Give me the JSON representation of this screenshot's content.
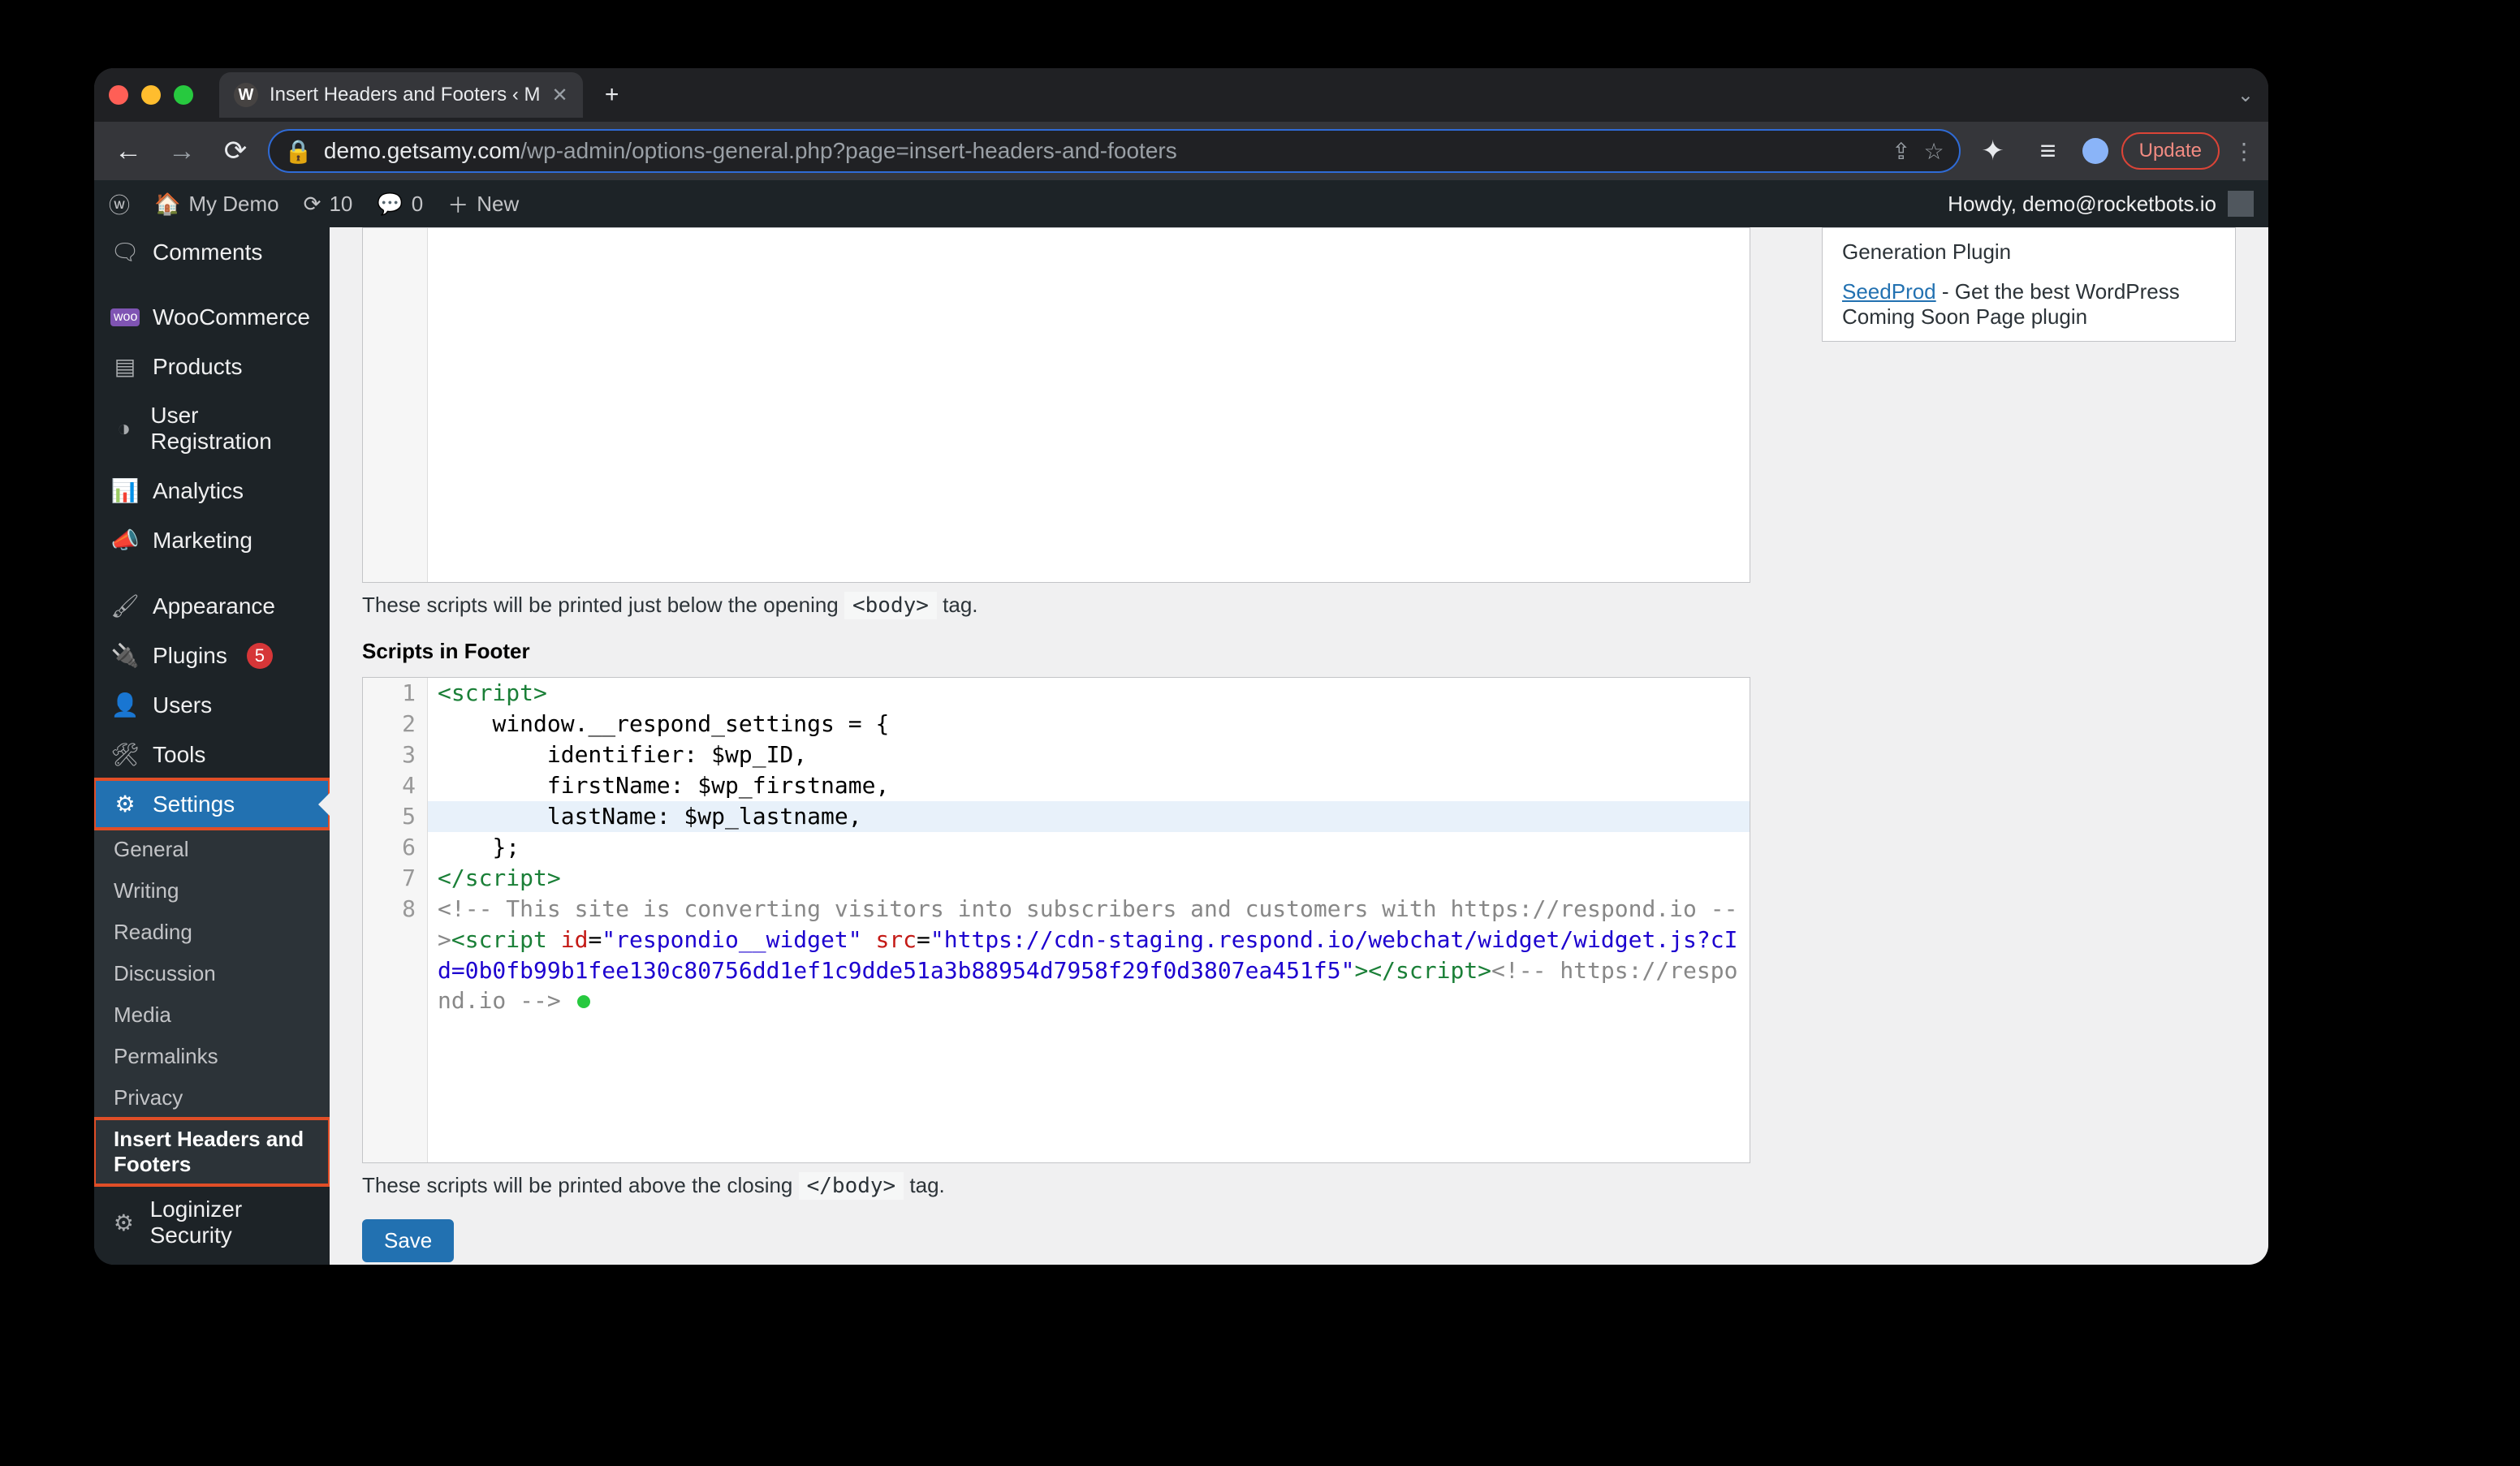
{
  "browser": {
    "tab_title": "Insert Headers and Footers ‹ M",
    "url_host": "demo.getsamy.com",
    "url_path": "/wp-admin/options-general.php?page=insert-headers-and-footers",
    "update_label": "Update"
  },
  "adminbar": {
    "site_name": "My Demo",
    "revisions": "10",
    "comments": "0",
    "new_label": "New",
    "howdy": "Howdy, demo@rocketbots.io"
  },
  "sidebar": {
    "items": [
      {
        "label": "Comments",
        "icon": "💬"
      },
      {
        "label": "WooCommerce",
        "icon": "woo"
      },
      {
        "label": "Products",
        "icon": "▥"
      },
      {
        "label": "User Registration",
        "icon": "◑"
      },
      {
        "label": "Analytics",
        "icon": "📊"
      },
      {
        "label": "Marketing",
        "icon": "📣"
      },
      {
        "label": "Appearance",
        "icon": "🖌"
      },
      {
        "label": "Plugins",
        "icon": "🔌",
        "badge": "5"
      },
      {
        "label": "Users",
        "icon": "👤"
      },
      {
        "label": "Tools",
        "icon": "🛠"
      },
      {
        "label": "Settings",
        "icon": "⚙",
        "current": true
      }
    ],
    "settings_sub": [
      "General",
      "Writing",
      "Reading",
      "Discussion",
      "Media",
      "Permalinks",
      "Privacy"
    ],
    "settings_sub_active": "Insert Headers and Footers",
    "loginizer": "Loginizer Security"
  },
  "content": {
    "body_helper_pre": "These scripts will be printed just below the opening ",
    "body_helper_code": "<body>",
    "body_helper_post": " tag.",
    "footer_label": "Scripts in Footer",
    "footer_helper_pre": "These scripts will be printed above the closing ",
    "footer_helper_code": "</body>",
    "footer_helper_post": " tag.",
    "save_label": "Save",
    "code": {
      "l1_a": "<script>",
      "l2": "    window.__respond_settings = {",
      "l3": "        identifier: $wp_ID,",
      "l4": "        firstName: $wp_firstname,",
      "l5": "        lastName: $wp_lastname,",
      "l6": "    };",
      "l7_a": "</script>",
      "l8_cmt1": "<!-- This site is converting visitors into subscribers and customers with https://respond.io -->",
      "l8_tag1": "<script ",
      "l8_attr1": "id",
      "l8_eq": "=",
      "l8_val1": "\"respondio__widget\"",
      "l8_attr2": " src",
      "l8_val2": "\"https://cdn-staging.respond.io/webchat/widget/widget.js?cId=0b0fb99b1fee130c80756dd1ef1c9dde51a3b88954d7958f29f0d3807ea451f5\"",
      "l8_tag2": "></script>",
      "l8_cmt2": "<!-- https://respond.io -->"
    }
  },
  "widget": {
    "line1_pre": "Generation Plugin",
    "link": "SeedProd",
    "line2": " - Get the best WordPress Coming Soon Page plugin"
  }
}
